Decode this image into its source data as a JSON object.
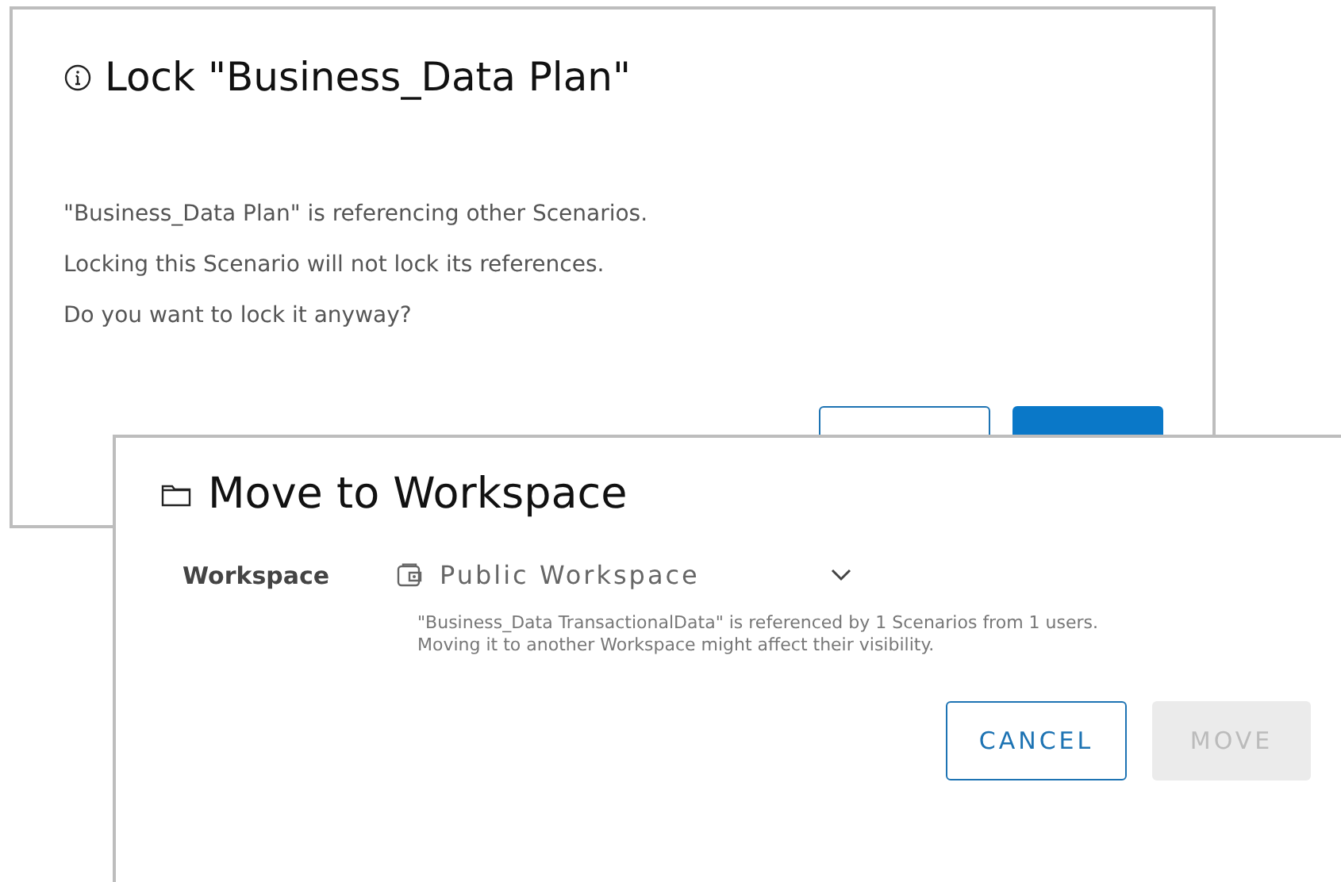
{
  "lock_dialog": {
    "title": "Lock \"Business_Data Plan\"",
    "message": [
      "\"Business_Data Plan\" is referencing other Scenarios.",
      "Locking this Scenario will not lock its references.",
      "Do you want to lock it anyway?"
    ],
    "buttons": [
      {
        "kind": "outline"
      },
      {
        "kind": "primary"
      }
    ]
  },
  "move_dialog": {
    "title": "Move to Workspace",
    "field_label": "Workspace",
    "workspace_value": "Public Workspace",
    "hint": [
      "\"Business_Data TransactionalData\" is referenced by 1 Scenarios from 1 users.",
      "Moving it to another Workspace might affect their visibility."
    ],
    "buttons": [
      {
        "label": "CANCEL",
        "kind": "outline",
        "disabled": false
      },
      {
        "label": "MOVE",
        "kind": "primary",
        "disabled": true
      }
    ]
  }
}
